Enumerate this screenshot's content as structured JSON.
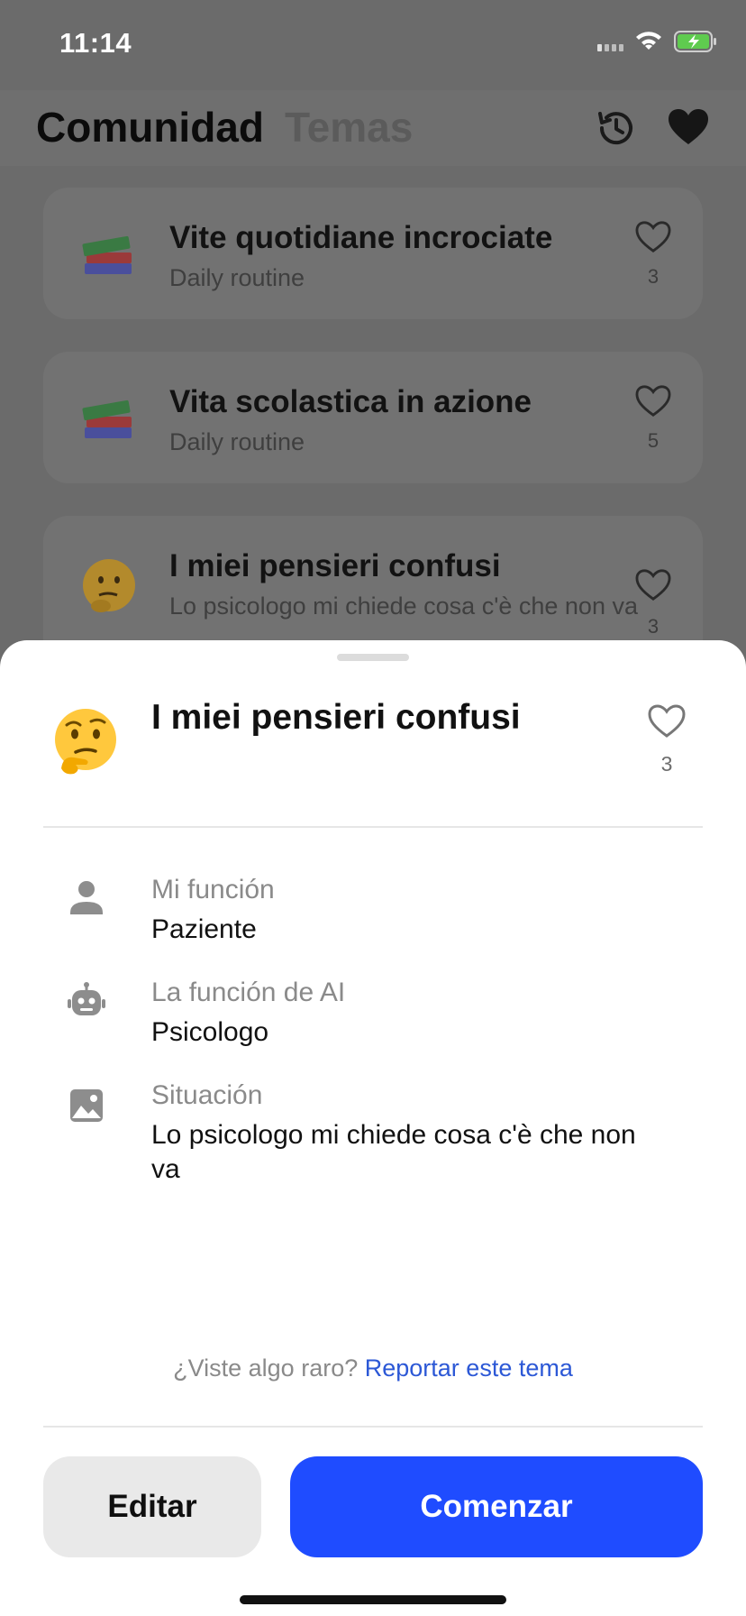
{
  "status_bar": {
    "time": "11:14"
  },
  "nav": {
    "tab_active": "Comunidad",
    "tab_inactive": "Temas",
    "history_icon": "history-icon",
    "favorites_icon": "heart-filled-icon"
  },
  "list": {
    "items": [
      {
        "emoji": "books",
        "title": "Vite quotidiane incrociate",
        "subtitle": "Daily routine",
        "likes": "3"
      },
      {
        "emoji": "books",
        "title": "Vita scolastica in azione",
        "subtitle": "Daily routine",
        "likes": "5"
      },
      {
        "emoji": "thinking-face",
        "title": "I miei pensieri confusi",
        "subtitle": "Lo psicologo mi chiede cosa c'è che non va",
        "likes": "3"
      }
    ]
  },
  "sheet": {
    "emoji": "thinking-face",
    "title": "I miei pensieri confusi",
    "likes": "3",
    "my_role_label": "Mi función",
    "my_role_value": "Paziente",
    "ai_role_label": "La función de AI",
    "ai_role_value": "Psicologo",
    "situation_label": "Situación",
    "situation_value": "Lo psicologo mi chiede cosa c'è che non va",
    "report_prefix": "¿Viste algo raro? ",
    "report_link": "Reportar este tema",
    "edit_label": "Editar",
    "start_label": "Comenzar"
  },
  "colors": {
    "accent": "#1f4cff",
    "link": "#2c58d6",
    "overlay": "#6b6b6b"
  }
}
